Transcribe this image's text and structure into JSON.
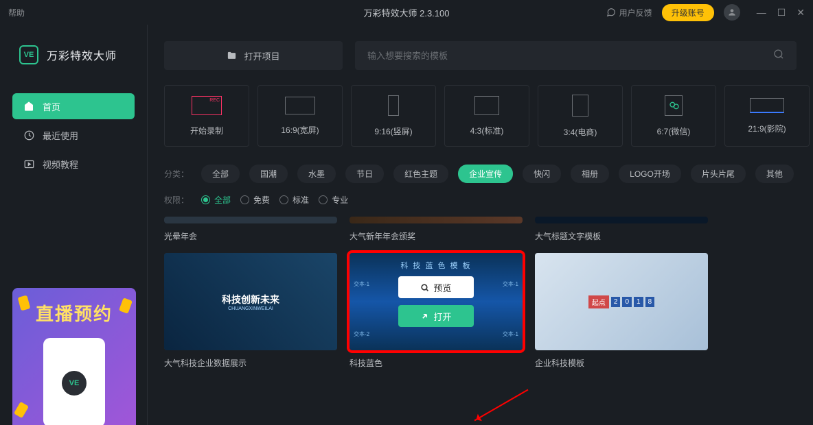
{
  "titlebar": {
    "help": "帮助",
    "title": "万彩特效大师 2.3.100",
    "feedback": "用户反馈",
    "upgrade": "升级账号"
  },
  "logo": {
    "icon": "VE",
    "text": "万彩特效大师"
  },
  "nav": {
    "home": "首页",
    "recent": "最近使用",
    "tutorial": "视频教程"
  },
  "promo": {
    "text": "直播预约",
    "badge": "VE"
  },
  "actions": {
    "open_project": "打开项目",
    "search_placeholder": "输入想要搜索的模板"
  },
  "ratios": {
    "record": "开始录制",
    "r169": "16:9(宽屏)",
    "r916": "9:16(竖屏)",
    "r43": "4:3(标准)",
    "r34": "3:4(电商)",
    "r67": "6:7(微信)",
    "r219": "21:9(影院)"
  },
  "filters": {
    "category_label": "分类：",
    "categories": {
      "all": "全部",
      "guochao": "国潮",
      "shuimo": "水墨",
      "jieri": "节日",
      "hongse": "红色主题",
      "qiye": "企业宣传",
      "kuaishan": "快闪",
      "xiangce": "相册",
      "logo": "LOGO开场",
      "piantou": "片头片尾",
      "other": "其他"
    },
    "perm_label": "权限：",
    "perms": {
      "all": "全部",
      "free": "免费",
      "standard": "标准",
      "pro": "专业"
    }
  },
  "gallery": {
    "row1": {
      "t1": "光晕年会",
      "t2": "大气新年年会颁奖",
      "t3": "大气标题文字模板"
    },
    "row2": {
      "t1": "大气科技企业数据展示",
      "t2": "科技蓝色",
      "t3": "企业科技模板",
      "thumb1_text": "科技创新未来",
      "thumb1_sub": "CHUANGXINWEILAI",
      "thumb2_text": "科 技 蓝 色 模 板",
      "thumb3_badge": "起点"
    },
    "overlay": {
      "preview": "预览",
      "open": "打开"
    }
  }
}
